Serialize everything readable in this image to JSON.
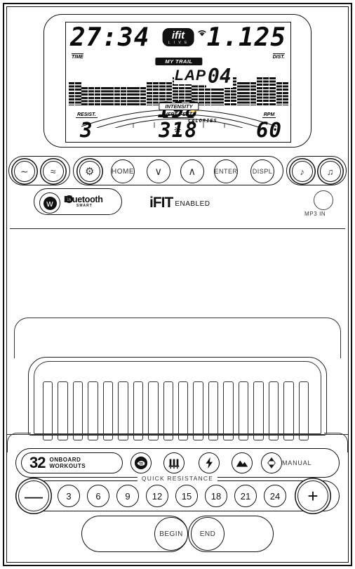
{
  "display": {
    "time": {
      "value": "27:34",
      "label": "TIME"
    },
    "distance": {
      "value": "1.125",
      "label": "DIST."
    },
    "brand_badge": {
      "name": "ifit",
      "sub": "L I V E"
    },
    "wifi_icon": "wifi-icon",
    "trail_label": "MY TRAIL",
    "lap_label": "LAP",
    "lap_value": "04",
    "intensity_label": "INTENSITY",
    "calories": {
      "value": "198",
      "label": "CALORIES"
    },
    "fan_icon": "fan-icon",
    "flame_icon": "flame-icon",
    "stats": [
      {
        "label": "RESIST.",
        "value": "3"
      },
      {
        "label": "VERT. FEET",
        "value": "318"
      },
      {
        "label": "RPM",
        "value": "60"
      }
    ]
  },
  "controls": {
    "left_pod": [
      {
        "name": "fan-button",
        "glyph": "∼"
      },
      {
        "name": "fan-speed-button",
        "glyph": "≈"
      }
    ],
    "mid_pod": [
      {
        "name": "brightness-button",
        "glyph": "⚙",
        "label": ""
      },
      {
        "name": "home-button",
        "glyph": "",
        "label": "HOME"
      },
      {
        "name": "down-button",
        "glyph": "∨",
        "label": ""
      },
      {
        "name": "up-button",
        "glyph": "∧",
        "label": ""
      },
      {
        "name": "enter-button",
        "glyph": "",
        "label": "ENTER"
      },
      {
        "name": "display-button",
        "glyph": "",
        "label": "DISPL"
      }
    ],
    "right_pod": [
      {
        "name": "volume-down-button",
        "glyph": "♪"
      },
      {
        "name": "volume-up-button",
        "glyph": "♫"
      }
    ]
  },
  "bluetooth": {
    "button_icon": "bluetooth-icon",
    "word": "Bluetooth",
    "sub": "SMART"
  },
  "ifit_enabled": {
    "brand": "iFIT",
    "suffix": "ENABLED"
  },
  "mp3": {
    "label": "MP3 IN"
  },
  "workouts": {
    "count": "32",
    "caption_line1": "ONBOARD",
    "caption_line2": "WORKOUTS",
    "buttons": [
      {
        "name": "brain-workout-button",
        "glyph": "◔"
      },
      {
        "name": "calorie-workout-button",
        "glyph": "☷"
      },
      {
        "name": "intensity-workout-button",
        "glyph": "⚡"
      },
      {
        "name": "incline-workout-button",
        "glyph": "▲"
      },
      {
        "name": "manual-workout-button",
        "glyph": "⇅"
      }
    ],
    "manual_label": "MANUAL"
  },
  "quick_resistance": {
    "label": "QUICK RESISTANCE",
    "minus": "—",
    "plus": "+",
    "levels": [
      "3",
      "6",
      "9",
      "12",
      "15",
      "18",
      "21",
      "24"
    ]
  },
  "actions": {
    "begin": "BEGIN",
    "end": "END"
  },
  "chart_like": {
    "matrix_profile": [
      5,
      5,
      4,
      4,
      4,
      4,
      4,
      4,
      4,
      4,
      4,
      4,
      5,
      5,
      5,
      5,
      6,
      6,
      6,
      5,
      5,
      5,
      5,
      5,
      6,
      6,
      5,
      5,
      5,
      6,
      6,
      6,
      5,
      5
    ]
  }
}
